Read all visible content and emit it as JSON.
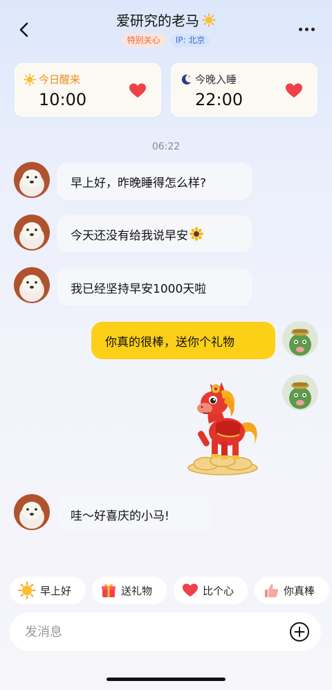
{
  "header": {
    "title": "爱研究的老马",
    "tag_special": "特别关心",
    "tag_ip": "IP: 北京"
  },
  "cards": {
    "wake": {
      "label": "今日醒来",
      "time": "10:00"
    },
    "sleep": {
      "label": "今晚入睡",
      "time": "22:00"
    }
  },
  "chat": {
    "timestamp": "06:22",
    "messages": [
      {
        "from": "friend",
        "text": "早上好，昨晚睡得怎么样?"
      },
      {
        "from": "friend",
        "text": "今天还没有给我说早安"
      },
      {
        "from": "friend",
        "text": "我已经坚持早安1000天啦"
      },
      {
        "from": "me",
        "text": "你真的很棒，送你个礼物"
      },
      {
        "from": "me",
        "type": "sticker",
        "sticker": "lucky-horse"
      },
      {
        "from": "friend",
        "text": "哇～好喜庆的小马!"
      }
    ]
  },
  "quick_replies": [
    {
      "icon": "sun-icon",
      "label": "早上好"
    },
    {
      "icon": "gift-icon",
      "label": "送礼物"
    },
    {
      "icon": "heart-icon",
      "label": "比个心"
    },
    {
      "icon": "thumbs-up-icon",
      "label": "你真棒"
    }
  ],
  "input": {
    "placeholder": "发消息"
  },
  "colors": {
    "accent_yellow": "#fbd016",
    "heart_red": "#f0414a",
    "wake_orange": "#f08a1c"
  }
}
